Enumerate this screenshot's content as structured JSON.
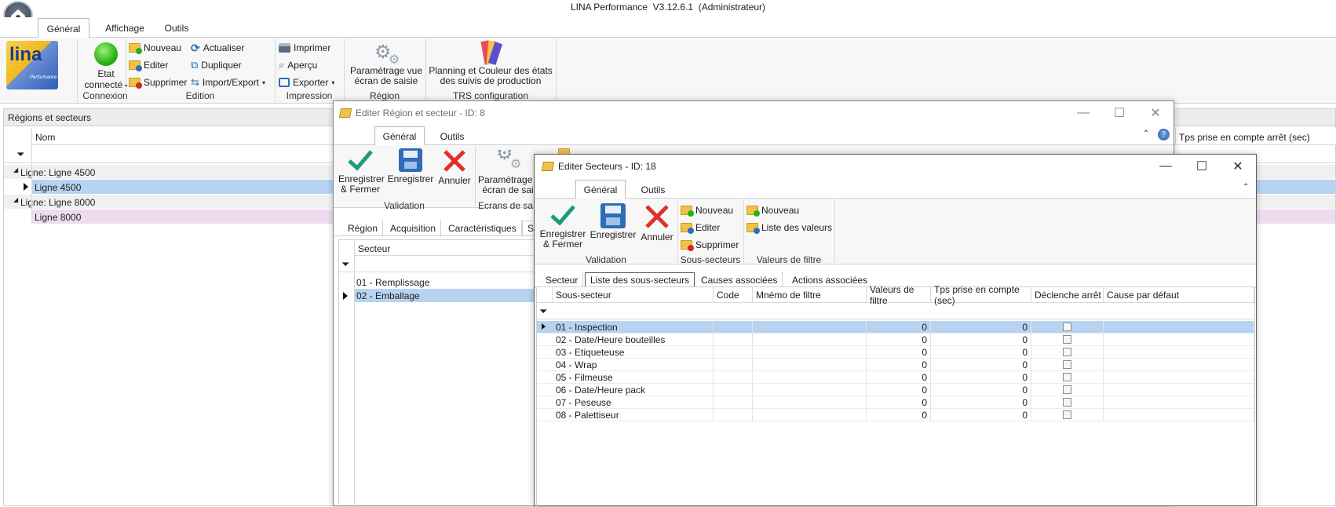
{
  "app": {
    "title": "LINA Performance  V3.12.6.1  (Administrateur)"
  },
  "ribbon": {
    "tabs": [
      "Général",
      "Affichage",
      "Outils"
    ],
    "logo_text": "lina",
    "logo_sub": "Performance",
    "connexion": {
      "state_label_line1": "Etat",
      "state_label_line2": "connecté",
      "group": "Connexion"
    },
    "edition": {
      "nouveau": "Nouveau",
      "editer": "Editer",
      "supprimer": "Supprimer",
      "actualiser": "Actualiser",
      "dupliquer": "Dupliquer",
      "import_export": "Import/Export",
      "group": "Edition"
    },
    "impression": {
      "imprimer": "Imprimer",
      "apercu": "Aperçu",
      "exporter": "Exporter",
      "group": "Impression"
    },
    "region": {
      "line1": "Paramétrage vue",
      "line2": "écran de saisie",
      "group": "Région"
    },
    "trs": {
      "line1": "Planning et Couleur des états",
      "line2": "des suivis de production",
      "group": "TRS configuration"
    }
  },
  "main_panel": {
    "title": "Régions et secteurs",
    "col_nom": "Nom",
    "right_col": "Tps prise en compte arrêt (sec)",
    "groups": [
      {
        "label": "Ligne: Ligne 4500",
        "row": "Ligne 4500"
      },
      {
        "label": "Ligne: Ligne 8000",
        "row": "Ligne 8000"
      }
    ]
  },
  "win_region": {
    "title": "Editer Région et secteur - ID: 8",
    "tabs": [
      "Général",
      "Outils"
    ],
    "btn_save_close_1": "Enregistrer",
    "btn_save_close_2": "& Fermer",
    "btn_save": "Enregistrer",
    "btn_cancel": "Annuler",
    "group_validation": "Validation",
    "param_1": "Paramétrage v",
    "param_2": "écran de sai",
    "group_ecrans": "Ecrans de sa",
    "subtabs": [
      "Région",
      "Acquisition",
      "Caractéristiques",
      "S"
    ],
    "col_secteur": "Secteur",
    "rows": [
      "01 - Remplissage",
      "02 - Emballage"
    ]
  },
  "win_secteurs": {
    "title": "Editer Secteurs - ID: 18",
    "tabs": [
      "Général",
      "Outils"
    ],
    "btn_save_close_1": "Enregistrer",
    "btn_save_close_2": "& Fermer",
    "btn_save": "Enregistrer",
    "btn_cancel": "Annuler",
    "group_validation": "Validation",
    "ss": {
      "nouveau": "Nouveau",
      "editer": "Editer",
      "supprimer": "Supprimer",
      "group": "Sous-secteurs"
    },
    "vf": {
      "nouveau": "Nouveau",
      "liste": "Liste des valeurs",
      "group": "Valeurs de filtre"
    },
    "subtabs": [
      "Secteur",
      "Liste des sous-secteurs",
      "Causes associées",
      "Actions associées"
    ],
    "columns": [
      "Sous-secteur",
      "Code",
      "Mnémo de filtre",
      "Valeurs de filtre",
      "Tps prise en compte (sec)",
      "Déclenche arrêt",
      "Cause par défaut"
    ],
    "rows": [
      {
        "name": "01 - Inspection",
        "vf": "0",
        "tps": "0"
      },
      {
        "name": "02 - Date/Heure bouteilles",
        "vf": "0",
        "tps": "0"
      },
      {
        "name": "03 - Etiqueteuse",
        "vf": "0",
        "tps": "0"
      },
      {
        "name": "04 - Wrap",
        "vf": "0",
        "tps": "0"
      },
      {
        "name": "05 - Filmeuse",
        "vf": "0",
        "tps": "0"
      },
      {
        "name": "06 - Date/Heure pack",
        "vf": "0",
        "tps": "0"
      },
      {
        "name": "07 - Peseuse",
        "vf": "0",
        "tps": "0"
      },
      {
        "name": "08 - Palettiseur",
        "vf": "0",
        "tps": "0"
      }
    ]
  },
  "colors": {
    "selection": "#b7d3f1",
    "accent": "#2f6db5",
    "ribbon_bg": "#f7f7f7"
  }
}
